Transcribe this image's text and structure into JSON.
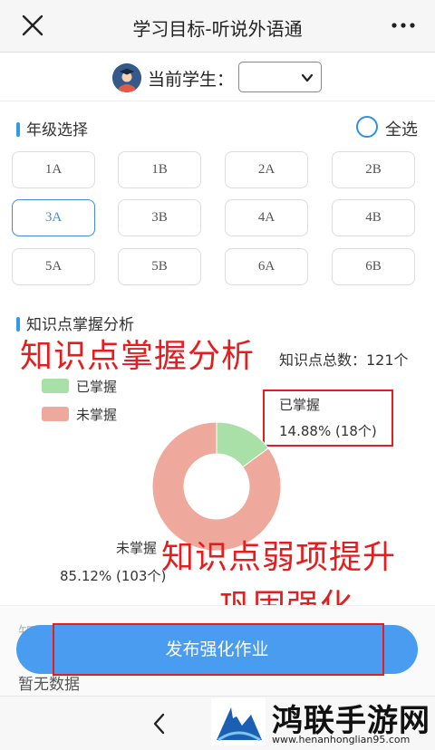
{
  "header": {
    "title": "学习目标-听说外语通",
    "close_icon": "close-icon",
    "more_icon": "more-icon"
  },
  "student": {
    "label": "当前学生：",
    "selected_value": ""
  },
  "grade_section": {
    "title": "年级选择",
    "select_all": "全选",
    "grades": [
      "1A",
      "1B",
      "2A",
      "2B",
      "3A",
      "3B",
      "4A",
      "4B",
      "5A",
      "5B",
      "6A",
      "6B"
    ],
    "active": "3A",
    "active_color": "#3e8fd6"
  },
  "analysis": {
    "title": "知识点掌握分析",
    "overlay_title": "知识点掌握分析",
    "total_label": "知识点总数：121个",
    "overlay_callout_1": "知识点弱项提升",
    "overlay_callout_2": "巩固强化"
  },
  "chart_data": {
    "type": "pie",
    "donut": true,
    "total": 121,
    "legend_position": "top-left",
    "slices": [
      {
        "name": "已掌握",
        "value": 18,
        "percent_label": "14.88% (18个)",
        "color": "#a8e0a7"
      },
      {
        "name": "未掌握",
        "value": 103,
        "percent_label": "85.12% (103个)",
        "color": "#eea99c"
      }
    ]
  },
  "lower": {
    "ghost_text": "知识",
    "empty_text": "暂无数据"
  },
  "actions": {
    "publish_label": "发布强化作业"
  },
  "nav": {
    "back_icon": "chevron-left-icon"
  },
  "watermark": {
    "name": "鸿联手游网",
    "url": "www.henanhonglian95.com"
  },
  "colors": {
    "accent": "#2f9be8",
    "button": "#4a9cf0",
    "annotation_red": "#e41e1e"
  }
}
